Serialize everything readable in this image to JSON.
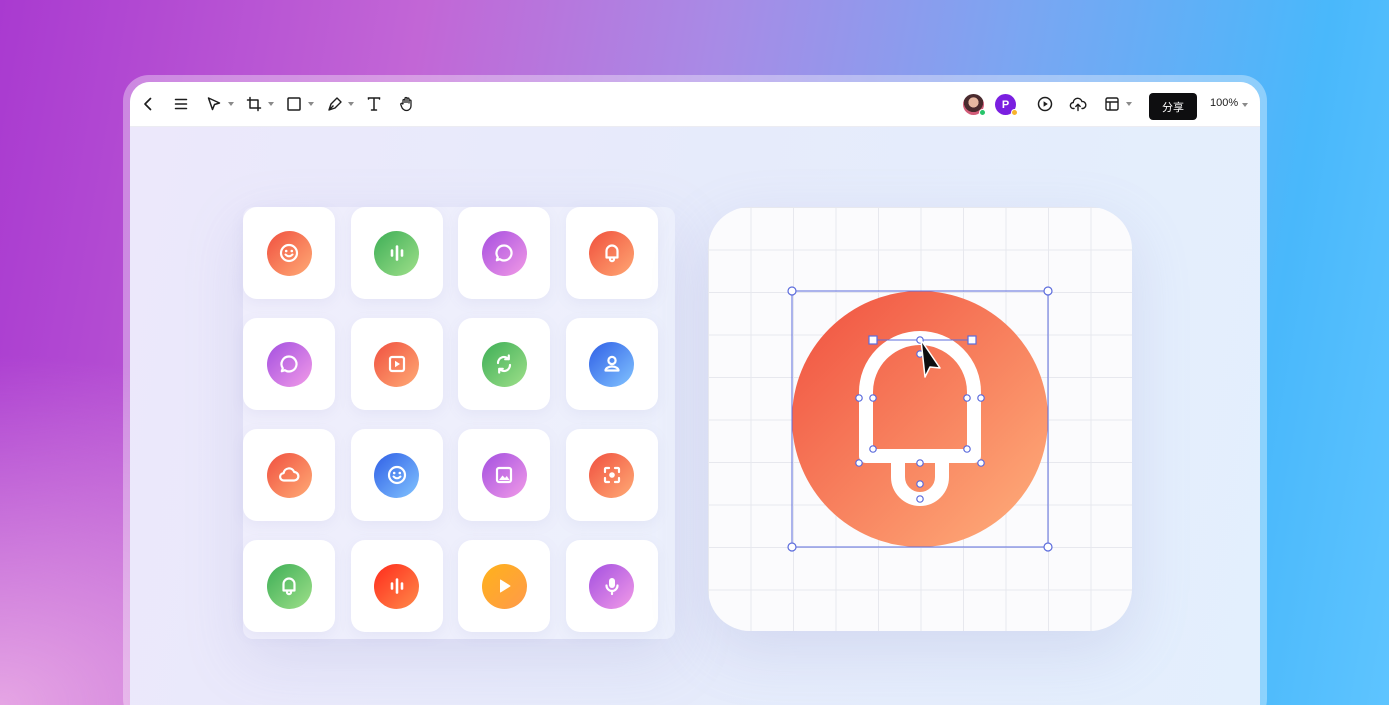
{
  "toolbar": {
    "tools": [
      {
        "name": "back-icon"
      },
      {
        "name": "menu-icon"
      },
      {
        "name": "pointer-tool-icon"
      },
      {
        "name": "crop-frame-tool-icon"
      },
      {
        "name": "rectangle-tool-icon"
      },
      {
        "name": "pen-tool-icon"
      },
      {
        "name": "text-tool-icon"
      },
      {
        "name": "hand-tool-icon"
      }
    ],
    "collaborators": [
      {
        "initial": "",
        "status_color": "#27c46a"
      },
      {
        "initial": "P",
        "status_color": "#f8b32b"
      }
    ],
    "actions": [
      {
        "name": "play-icon"
      },
      {
        "name": "upload-cloud-icon"
      },
      {
        "name": "layout-icon"
      }
    ],
    "share_label": "分享",
    "zoom_label": "100%"
  },
  "icon_grid": [
    {
      "icon": "smiley-icon",
      "gradient": [
        "#f0503f",
        "#ffab76"
      ]
    },
    {
      "icon": "audio-wave-icon",
      "gradient": [
        "#3dae56",
        "#9fe08a"
      ]
    },
    {
      "icon": "chat-bubble-icon",
      "gradient": [
        "#a64fe0",
        "#f29ae6"
      ]
    },
    {
      "icon": "bell-icon",
      "gradient": [
        "#f04f3c",
        "#ffa874"
      ]
    },
    {
      "icon": "chat-bubble-icon",
      "gradient": [
        "#a34fe0",
        "#f29be8"
      ]
    },
    {
      "icon": "video-play-icon",
      "gradient": [
        "#f0503f",
        "#ffab76"
      ]
    },
    {
      "icon": "refresh-icon",
      "gradient": [
        "#3dae56",
        "#9fe08a"
      ]
    },
    {
      "icon": "user-icon",
      "gradient": [
        "#2f5fe6",
        "#82c4ff"
      ]
    },
    {
      "icon": "cloud-icon",
      "gradient": [
        "#f0503f",
        "#ffab76"
      ]
    },
    {
      "icon": "smiley-icon",
      "gradient": [
        "#2f5fe6",
        "#82c4ff"
      ]
    },
    {
      "icon": "image-icon",
      "gradient": [
        "#a34fe0",
        "#f29be8"
      ]
    },
    {
      "icon": "focus-camera-icon",
      "gradient": [
        "#f0503f",
        "#ffab76"
      ]
    },
    {
      "icon": "bell-icon",
      "gradient": [
        "#3dae56",
        "#9fe08a"
      ]
    },
    {
      "icon": "audio-wave-icon",
      "gradient": [
        "#ff2b1c",
        "#ff8a4a"
      ]
    },
    {
      "icon": "play-icon",
      "gradient": [
        "#ffb21a",
        "#ff9a4a"
      ]
    },
    {
      "icon": "microphone-icon",
      "gradient": [
        "#a34fe0",
        "#f29be8"
      ]
    }
  ],
  "editor": {
    "selected_icon": "bell-icon",
    "gradient": [
      "#f0503f",
      "#ffb07c"
    ],
    "selection_color": "#5b6bdc"
  }
}
